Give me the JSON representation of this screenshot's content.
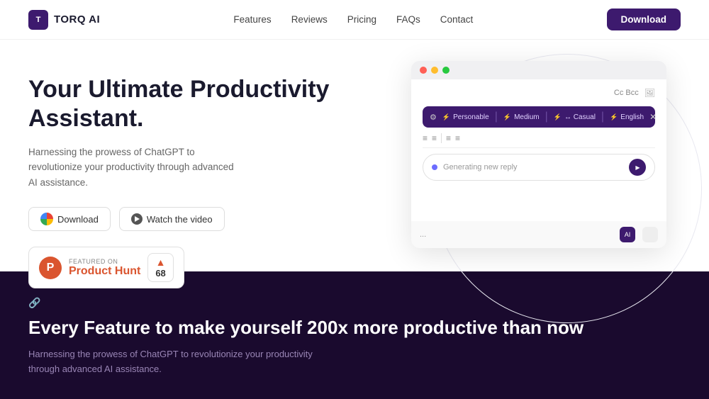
{
  "navbar": {
    "logo_text": "TORQ AI",
    "nav_items": [
      "Features",
      "Reviews",
      "Pricing",
      "FAQs",
      "Contact"
    ],
    "download_label": "Download"
  },
  "hero": {
    "title": "Your Ultimate Productivity Assistant.",
    "description": "Harnessing the prowess of ChatGPT to revolutionize your productivity through advanced AI assistance.",
    "btn_download": "Download",
    "btn_watch": "Watch the video",
    "ph_featured": "FEATURED ON",
    "ph_name": "Product Hunt",
    "ph_votes": "68"
  },
  "browser": {
    "email_cc": "Cc  Bcc",
    "toolbar_items": [
      "Personable",
      "Medium",
      "Casual",
      "English"
    ],
    "ai_reply_text": "Generating new reply",
    "format_btns": [
      "≡",
      "≡",
      "≡",
      "≡"
    ]
  },
  "dark_section": {
    "title": "Every Feature to make yourself 200x more productive than now",
    "description": "Harnessing the prowess of ChatGPT to revolutionize your productivity through advanced AI assistance."
  }
}
